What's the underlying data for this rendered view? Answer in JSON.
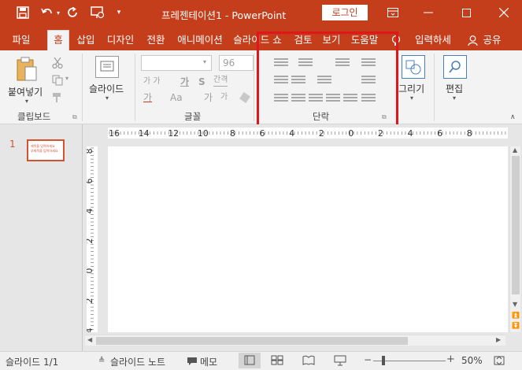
{
  "window": {
    "title": "프레젠테이션1 - PowerPoint",
    "login_label": "로그인"
  },
  "tabs": [
    "파일",
    "홈",
    "삽입",
    "디자인",
    "전환",
    "애니메이션",
    "슬라이드 쇼",
    "검토",
    "보기",
    "도움말"
  ],
  "search_label": "입력하세",
  "share_label": "공유",
  "ribbon": {
    "clipboard": {
      "paste_label": "붙여넣기",
      "group_label": "클립보드"
    },
    "slides": {
      "new_slide_label": "슬라이드"
    },
    "font": {
      "size_value": "96",
      "group_label": "글꼴",
      "spacing_label": "간격",
      "size_label": "가 가",
      "case_label": "Aa"
    },
    "paragraph": {
      "group_label": "단락"
    },
    "drawing": {
      "label": "그리기"
    },
    "editing": {
      "label": "편집"
    }
  },
  "ruler": {
    "h_labels": [
      "16",
      "14",
      "12",
      "10",
      "8",
      "6",
      "4",
      "2",
      "0",
      "2",
      "4",
      "6",
      "8"
    ],
    "v_labels": [
      "8",
      "6",
      "4",
      "2",
      "0",
      "2",
      "4"
    ]
  },
  "slide_panel": {
    "number": "1",
    "thumb_text": "제목을 입력하세요\n부제목을 입력하세요"
  },
  "status": {
    "slide_info": "슬라이드 1/1",
    "notes_label": "슬라이드 노트",
    "memo_label": "메모",
    "zoom": "50%"
  },
  "highlight_color": "#e0161b"
}
